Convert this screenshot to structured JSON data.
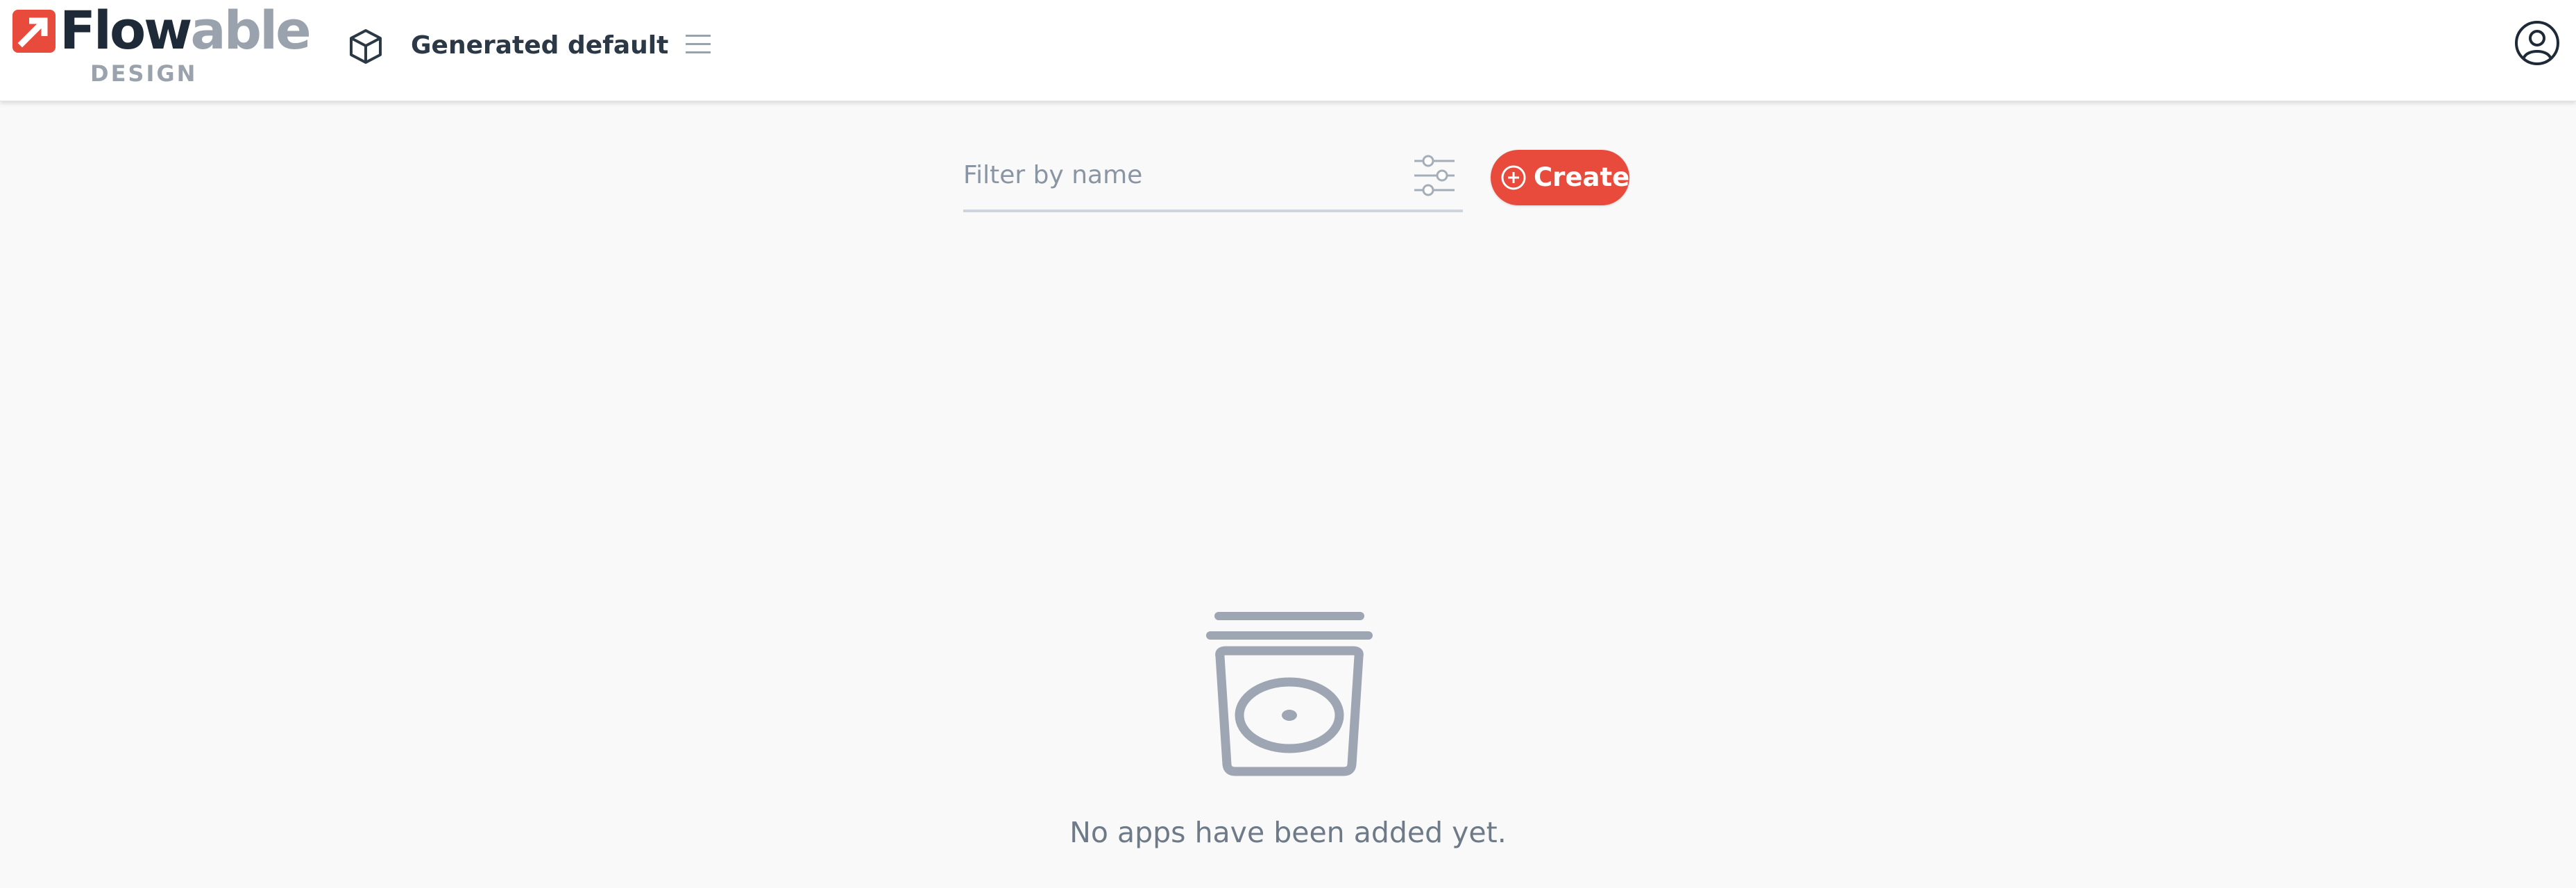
{
  "brand": {
    "wordmark_dark": "Flow",
    "wordmark_light": "able",
    "subtitle": "DESIGN",
    "accent_color": "#e84b3c"
  },
  "header": {
    "workspace_name": "Generated default",
    "workspace_icon": "cube-icon",
    "menu_icon": "hamburger-menu-icon",
    "user_icon": "user-account-icon"
  },
  "toolbar": {
    "filter_placeholder": "Filter by name",
    "filter_value": "",
    "filter_options_icon": "sliders-icon",
    "create_label": "Create",
    "create_icon": "plus-circle-icon"
  },
  "empty_state": {
    "icon": "empty-apps-icon",
    "message": "No apps have been added yet."
  }
}
